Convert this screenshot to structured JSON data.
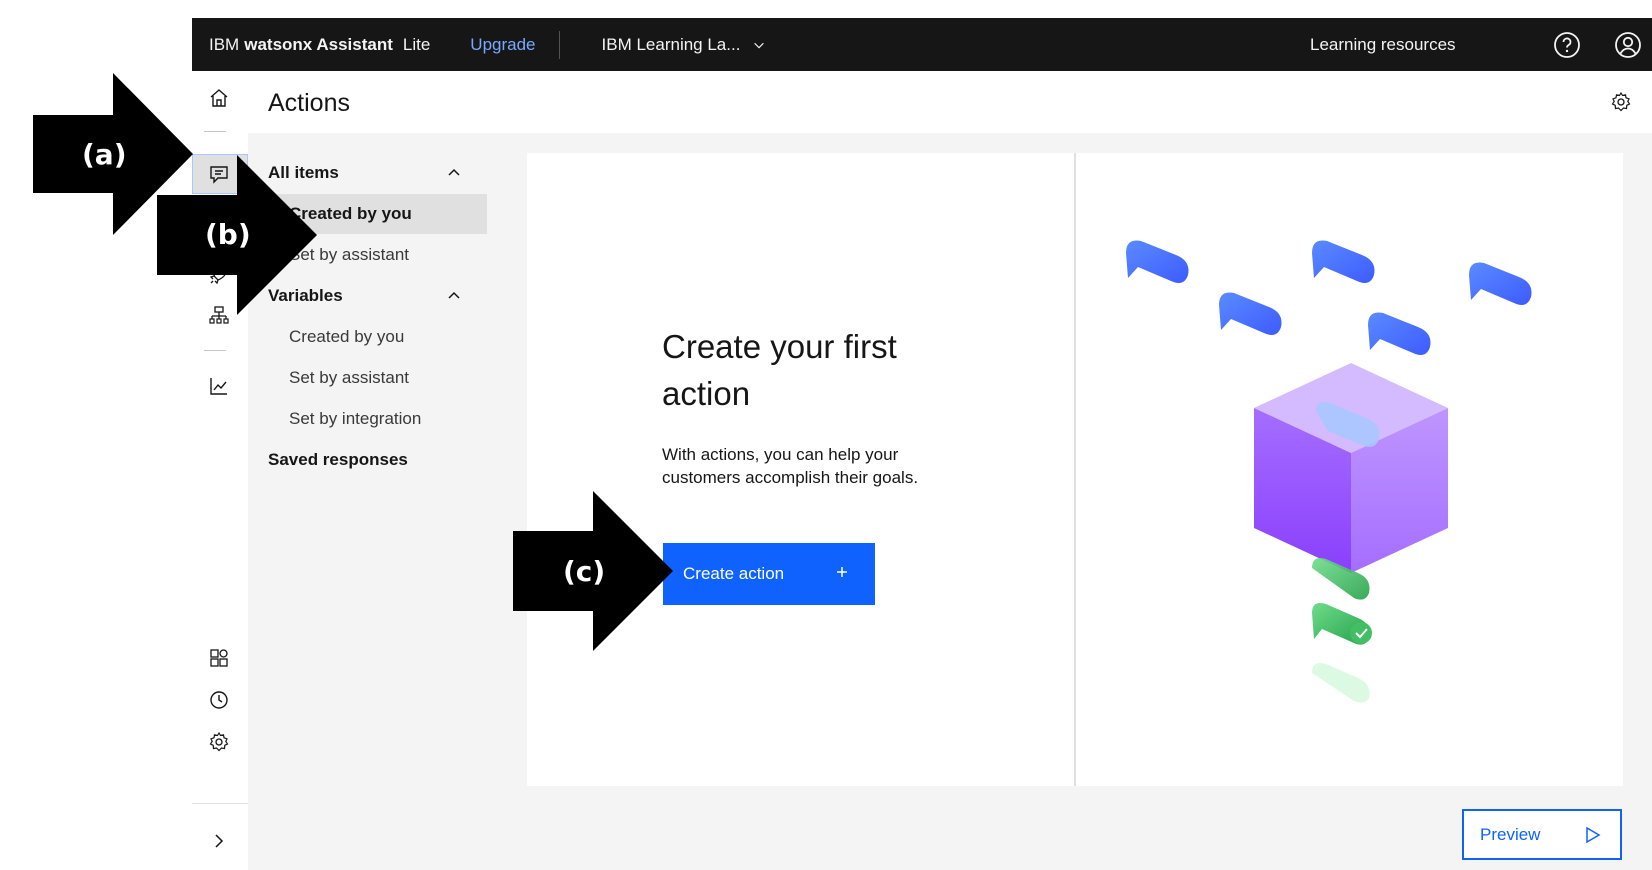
{
  "topbar": {
    "brand_ibm": "IBM",
    "brand_product": "watsonx Assistant",
    "brand_plan": "Lite",
    "upgrade_label": "Upgrade",
    "instance_name": "IBM Learning La...",
    "learning_resources": "Learning resources"
  },
  "page": {
    "title": "Actions"
  },
  "subnav": {
    "all_items": "All items",
    "all_items_children": [
      "Created by you",
      "Set by assistant"
    ],
    "variables": "Variables",
    "variables_children": [
      "Created by you",
      "Set by assistant",
      "Set by integration"
    ],
    "saved_responses": "Saved responses"
  },
  "empty_state": {
    "title": "Create your first action",
    "description": "With actions, you can help your customers accomplish their goals.",
    "button_label": "Create action"
  },
  "preview": {
    "label": "Preview"
  },
  "annotations": {
    "a": "(a)",
    "b": "(b)",
    "c": "(c)"
  },
  "colors": {
    "topbar": "#161616",
    "link": "#78a9ff",
    "primary": "#0f62fe",
    "panel": "#f4f4f4",
    "selected": "#e0e0e0"
  }
}
